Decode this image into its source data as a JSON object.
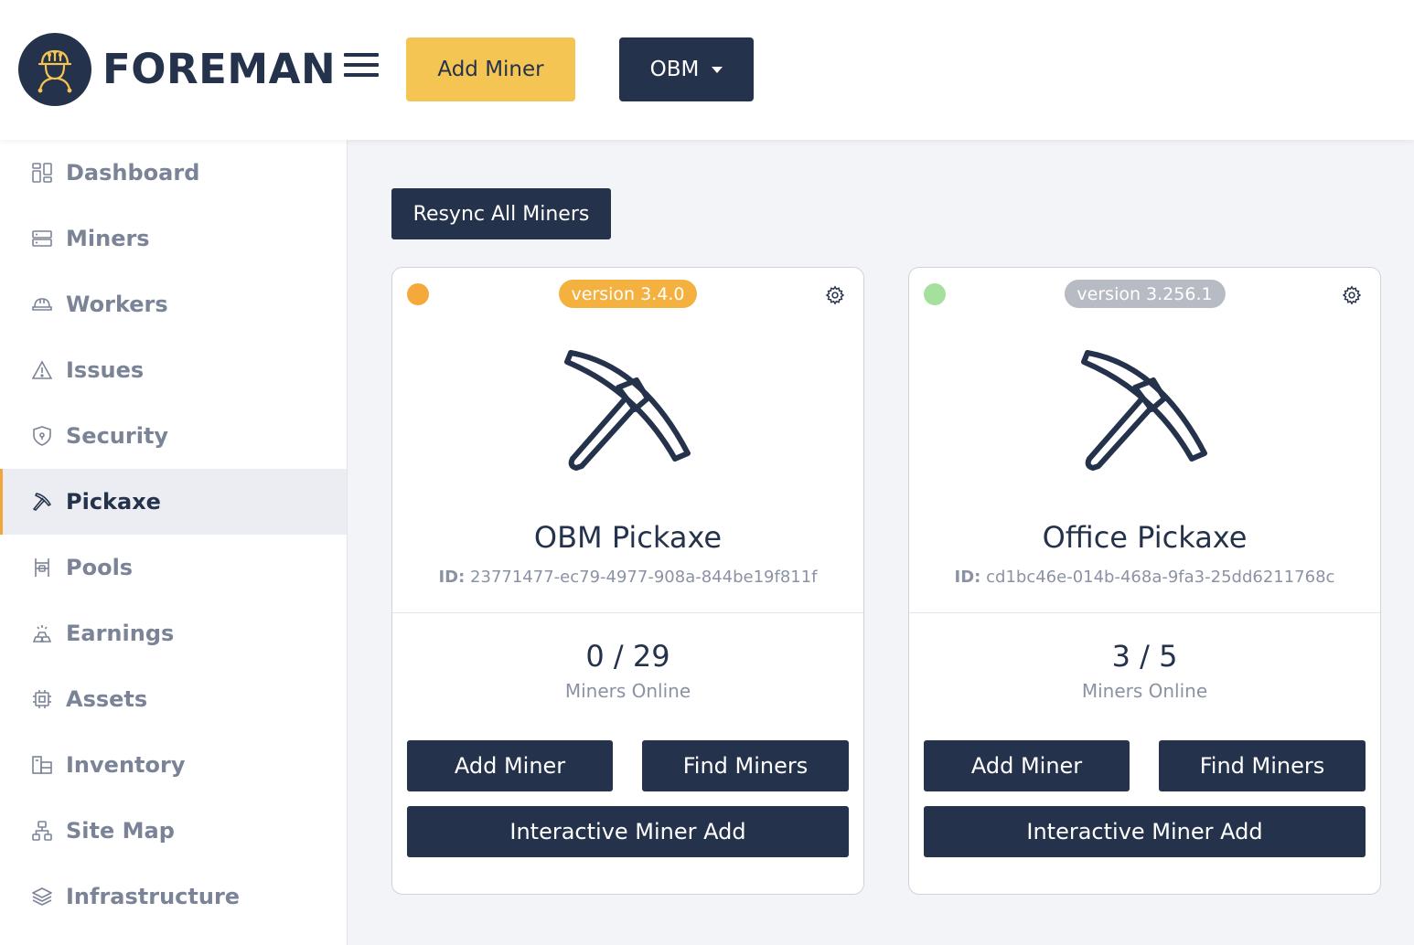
{
  "header": {
    "logo_text": "FOREMAN",
    "add_miner_label": "Add Miner",
    "org_selector_label": "OBM",
    "accent_color": "#f4c553",
    "primary_color": "#25324b"
  },
  "sidebar": {
    "active_item": "Pickaxe",
    "items": [
      {
        "label": "Dashboard",
        "icon": "dashboard-icon"
      },
      {
        "label": "Miners",
        "icon": "server-icon"
      },
      {
        "label": "Workers",
        "icon": "hard-hat-icon"
      },
      {
        "label": "Issues",
        "icon": "warning-triangle-icon"
      },
      {
        "label": "Security",
        "icon": "shield-icon"
      },
      {
        "label": "Pickaxe",
        "icon": "pickaxe-icon"
      },
      {
        "label": "Pools",
        "icon": "pools-icon"
      },
      {
        "label": "Earnings",
        "icon": "gold-bars-icon"
      },
      {
        "label": "Assets",
        "icon": "chip-icon"
      },
      {
        "label": "Inventory",
        "icon": "boxes-icon"
      },
      {
        "label": "Site Map",
        "icon": "sitemap-icon"
      },
      {
        "label": "Infrastructure",
        "icon": "layers-icon"
      }
    ]
  },
  "main": {
    "resync_label": "Resync All Miners",
    "cards": [
      {
        "version": "version 3.4.0",
        "version_color": "#f4b13f",
        "status_color": "#f4a93a",
        "title": "OBM Pickaxe",
        "id_label": "ID:",
        "id_value": "23771477-ec79-4977-908a-844be19f811f",
        "count": "0 / 29",
        "count_label": "Miners Online",
        "add_label": "Add Miner",
        "find_label": "Find Miners",
        "interactive_label": "Interactive Miner Add"
      },
      {
        "version": "version 3.256.1",
        "version_color": "#b7bbc3",
        "status_color": "#a3e19c",
        "title": "Office Pickaxe",
        "id_label": "ID:",
        "id_value": "cd1bc46e-014b-468a-9fa3-25dd6211768c",
        "count": "3 / 5",
        "count_label": "Miners Online",
        "add_label": "Add Miner",
        "find_label": "Find Miners",
        "interactive_label": "Interactive Miner Add"
      }
    ]
  }
}
